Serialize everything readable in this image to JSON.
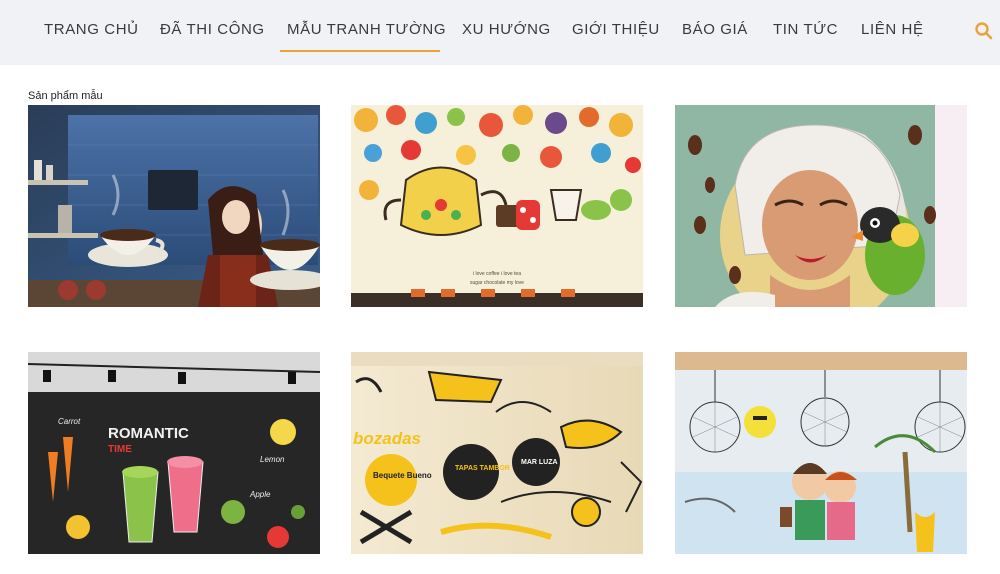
{
  "nav": {
    "items": [
      {
        "label": "TRANG CHỦ"
      },
      {
        "label": "ĐÃ THI CÔNG"
      },
      {
        "label": "MẪU TRANH TƯỜNG"
      },
      {
        "label": "XU HƯỚNG"
      },
      {
        "label": "GIỚI THIỆU"
      },
      {
        "label": "BÁO GIÁ"
      },
      {
        "label": "TIN TỨC"
      },
      {
        "label": "LIÊN HỆ"
      }
    ],
    "active_index": 2,
    "search_icon": "search-icon"
  },
  "section": {
    "label": "Sản phẩm mẫu"
  },
  "cards": [
    {
      "name": "coffee-waitress-mural"
    },
    {
      "name": "teapot-doodle-mural",
      "caption_1": "i love coffee i love tea",
      "caption_2": "sugar chocolate my love"
    },
    {
      "name": "woman-parrot-mural"
    },
    {
      "name": "romantic-time-smoothie-mural",
      "headline": "ROMANTIC",
      "subline": "TIME",
      "labels": [
        "Carrot",
        "Lemon",
        "Apple"
      ]
    },
    {
      "name": "tapas-yellow-wall-mural",
      "texts": [
        "bozadas",
        "Bequete Bueno",
        "TAPAS TAMBOR",
        "MAR LUZA"
      ]
    },
    {
      "name": "beach-cartoon-mural"
    }
  ],
  "colors": {
    "accent": "#e8a33d",
    "nav_bg": "#f1f2f6",
    "nav_text": "#3a3a3a"
  }
}
